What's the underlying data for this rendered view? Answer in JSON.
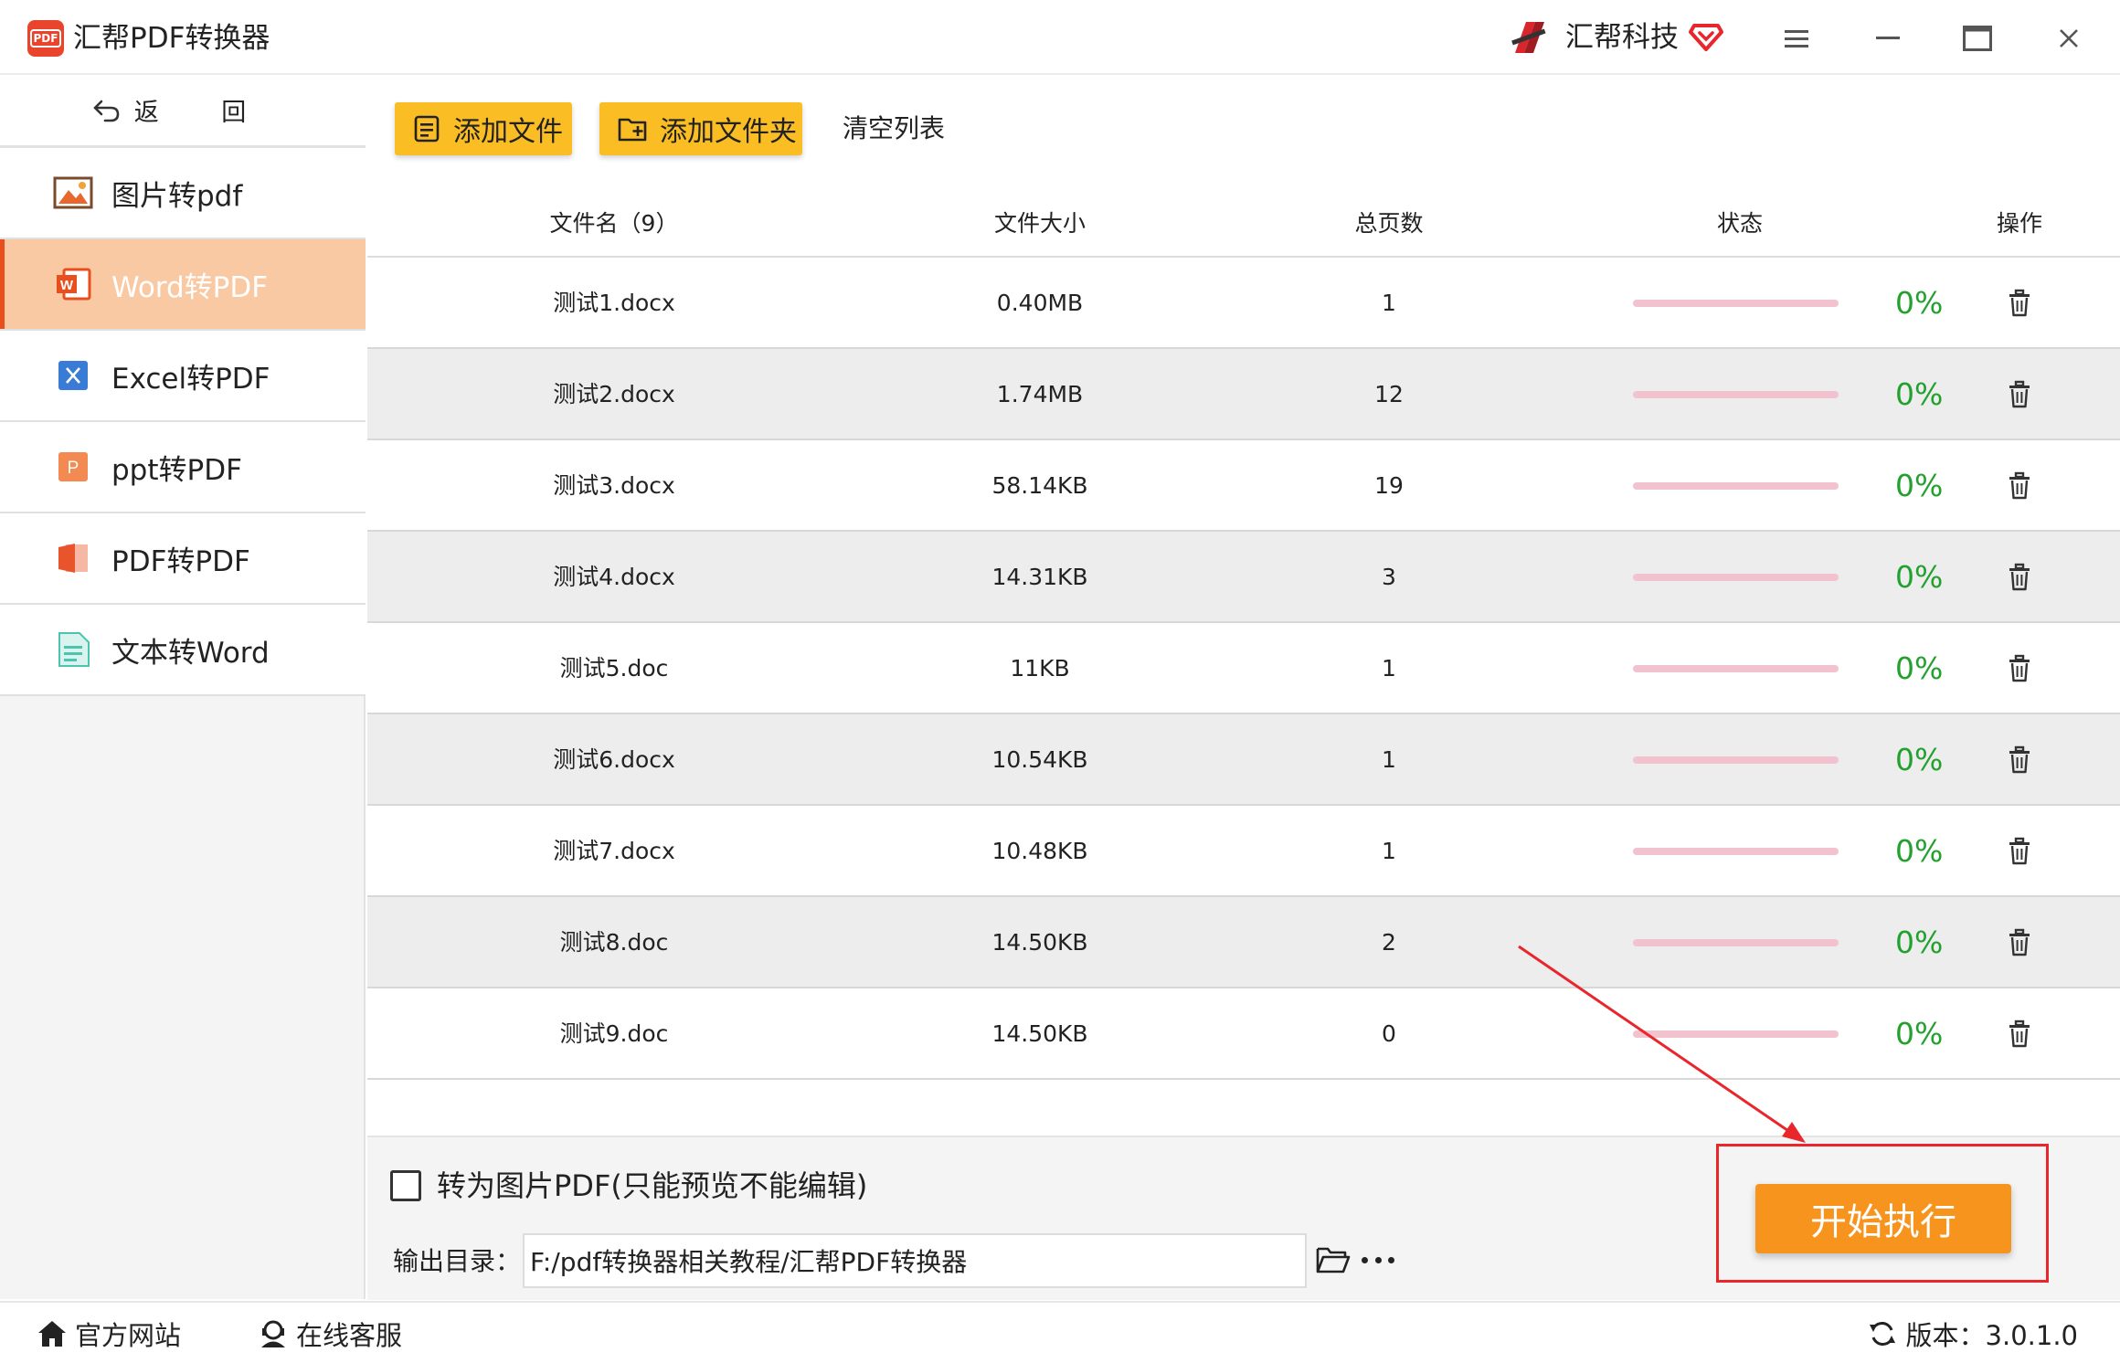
{
  "window": {
    "title": "汇帮PDF转换器",
    "logo_text": "PDF",
    "brand": "汇帮科技"
  },
  "sidebar": {
    "back_label": "返 回",
    "items": [
      {
        "label": "图片转pdf",
        "icon": "image-icon",
        "active": false
      },
      {
        "label": "Word转PDF",
        "icon": "word-icon",
        "active": true
      },
      {
        "label": "Excel转PDF",
        "icon": "excel-icon",
        "active": false
      },
      {
        "label": "ppt转PDF",
        "icon": "ppt-icon",
        "active": false
      },
      {
        "label": "PDF转PDF",
        "icon": "pdf-icon",
        "active": false
      },
      {
        "label": "文本转Word",
        "icon": "text-doc-icon",
        "active": false
      }
    ]
  },
  "toolbar": {
    "add_file": "添加文件",
    "add_folder": "添加文件夹",
    "clear_list": "清空列表"
  },
  "table": {
    "headers": {
      "name": "文件名（9）",
      "size": "文件大小",
      "pages": "总页数",
      "status": "状态",
      "action": "操作"
    },
    "rows": [
      {
        "name": "测试1.docx",
        "size": "0.40MB",
        "pages": "1",
        "progress": "0%",
        "progress_value": 0
      },
      {
        "name": "测试2.docx",
        "size": "1.74MB",
        "pages": "12",
        "progress": "0%",
        "progress_value": 0
      },
      {
        "name": "测试3.docx",
        "size": "58.14KB",
        "pages": "19",
        "progress": "0%",
        "progress_value": 0
      },
      {
        "name": "测试4.docx",
        "size": "14.31KB",
        "pages": "3",
        "progress": "0%",
        "progress_value": 0
      },
      {
        "name": "测试5.doc",
        "size": "11KB",
        "pages": "1",
        "progress": "0%",
        "progress_value": 0
      },
      {
        "name": "测试6.docx",
        "size": "10.54KB",
        "pages": "1",
        "progress": "0%",
        "progress_value": 0
      },
      {
        "name": "测试7.docx",
        "size": "10.48KB",
        "pages": "1",
        "progress": "0%",
        "progress_value": 0
      },
      {
        "name": "测试8.doc",
        "size": "14.50KB",
        "pages": "2",
        "progress": "0%",
        "progress_value": 0
      },
      {
        "name": "测试9.doc",
        "size": "14.50KB",
        "pages": "0",
        "progress": "0%",
        "progress_value": 0
      }
    ]
  },
  "options": {
    "image_pdf_label": "转为图片PDF(只能预览不能编辑)",
    "image_pdf_checked": false,
    "output_label": "输出目录：",
    "output_path": "F:/pdf转换器相关教程/汇帮PDF转换器",
    "start_button": "开始执行"
  },
  "statusbar": {
    "website": "官方网站",
    "support": "在线客服",
    "version": "版本：3.0.1.0"
  },
  "colors": {
    "accent_yellow": "#fbbd24",
    "active_nav": "#f8c9a3",
    "start_orange": "#f7941d",
    "progress_green": "#22a12e",
    "highlight_red": "#e8262c"
  }
}
